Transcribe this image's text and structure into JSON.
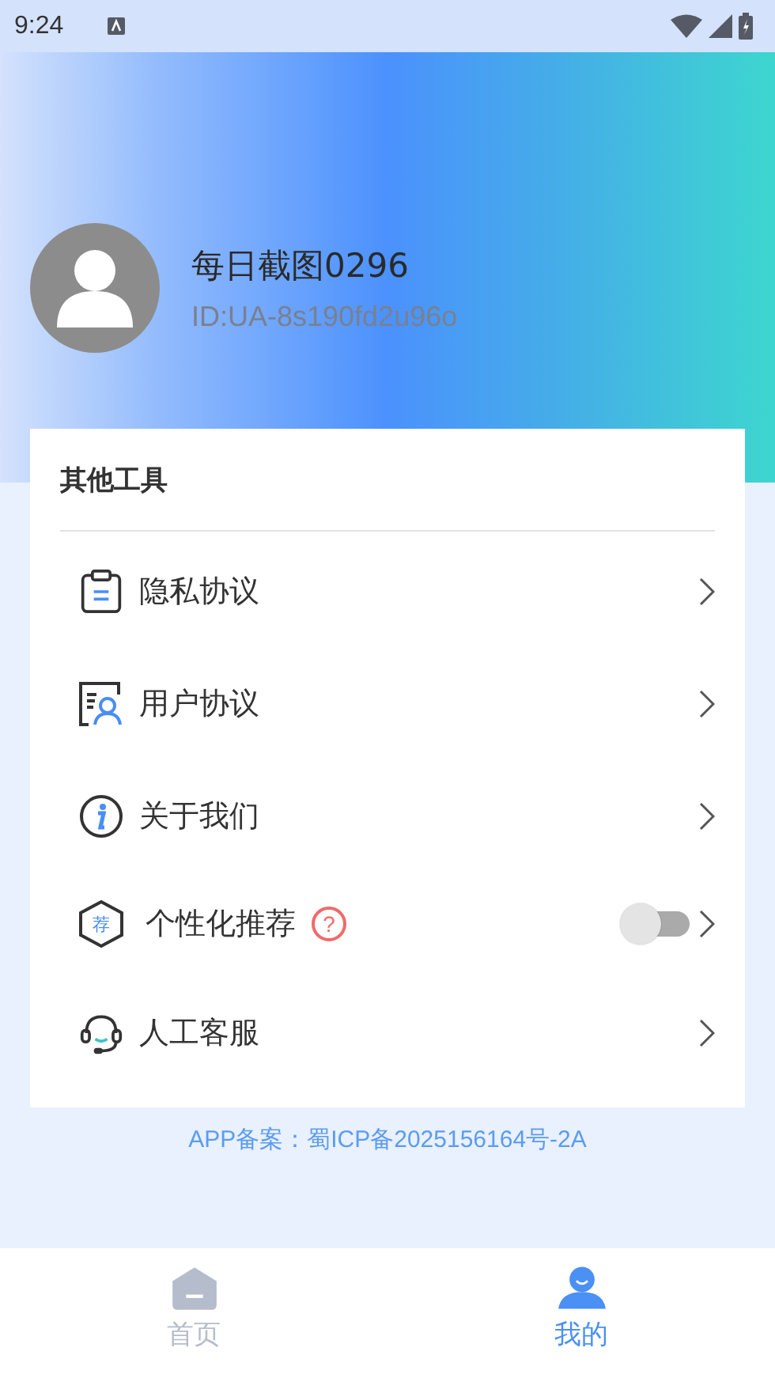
{
  "status_bar": {
    "time": "9:24"
  },
  "profile": {
    "name": "每日截图0296",
    "user_id": "ID:UA-8s190fd2u96o"
  },
  "tools_card": {
    "title": "其他工具",
    "items": [
      {
        "kind": "link",
        "label": "隐私协议"
      },
      {
        "kind": "link",
        "label": "用户协议"
      },
      {
        "kind": "link",
        "label": "关于我们"
      },
      {
        "kind": "toggle",
        "label": "个性化推荐",
        "on": false,
        "help_icon_text": "?",
        "badge_text": "荐"
      },
      {
        "kind": "link",
        "label": "人工客服"
      }
    ]
  },
  "footer": {
    "record": "APP备案：蜀ICP备2025156164号-2A"
  },
  "bottom_nav": [
    {
      "label": "首页",
      "selected": false
    },
    {
      "label": "我的",
      "selected": true
    }
  ]
}
